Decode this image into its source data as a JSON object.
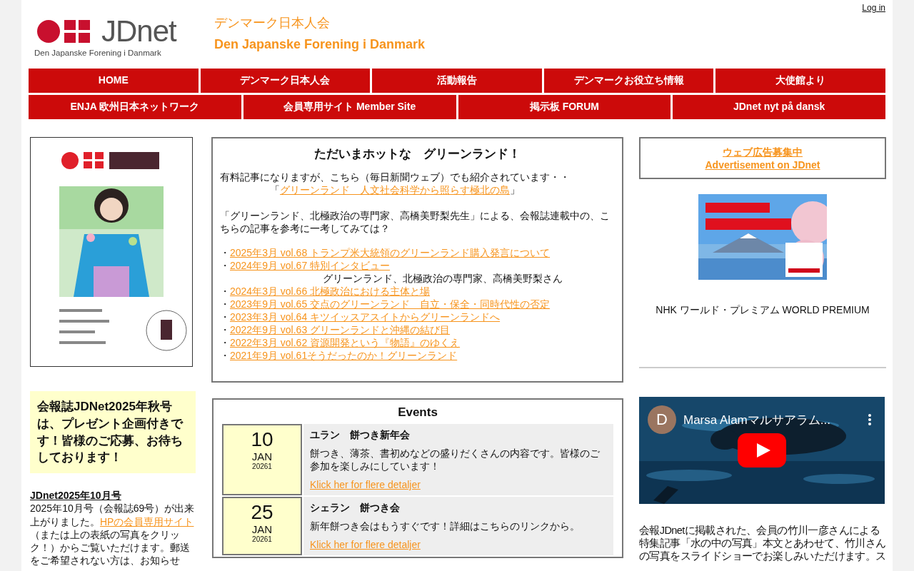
{
  "login": "Log in",
  "logo": {
    "name": "JDnet",
    "subtitle": "Den Japanske Forening i Danmark"
  },
  "site_title": {
    "ja": "デンマーク日本人会",
    "da": "Den Japanske Forening i Danmark"
  },
  "nav_rows": [
    [
      "HOME",
      "デンマーク日本人会",
      "活動報告",
      "デンマークお役立ち情報",
      "大使館より"
    ],
    [
      "ENJA 欧州日本ネットワーク",
      "会員専用サイト Member Site",
      "掲示板 FORUM",
      "JDnet nyt på dansk"
    ]
  ],
  "left": {
    "notice": "会報誌JDNet2025年秋号は、プレゼント企画付きです！皆様のご応募、お待ちしております！",
    "issue_title": "JDnet2025年10月号",
    "issue_text_before": "2025年10月号（会報誌69号）が出来上がりました。",
    "issue_link": "HPの会員専用サイト",
    "issue_text_after": "（または上の表紙の写真をクリック！）からご覧いただけます。郵送をご希望されない方は、お知らせ"
  },
  "hot": {
    "title": "ただいまホットな　グリーンランド！",
    "intro": "有料記事になりますが、こちら（毎日新聞ウェブ）でも紹介されています・・",
    "quote_open": "「",
    "quote_link": "グリーンランド　人文社会科学から照らす極北の島",
    "quote_close": "」",
    "lead": "「グリーンランド、北極政治の専門家、高橋美野梨先生」による、会報誌連載中の、こちらの記事を参考に一考してみては？",
    "bullet": "・",
    "articles": [
      {
        "link": "2025年3月 vol.68  トランプ米大統領のグリーンランド購入発言について"
      },
      {
        "link": "2024年9月 vol.67  特別インタビュー",
        "note": "グリーンランド、北極政治の専門家、高橋美野梨さん"
      },
      {
        "link": "2024年3月 vol.66  北極政治における主体と場"
      },
      {
        "link": "2023年9月 vol.65  交点のグリーンランド　自立・保全・同時代性の否定"
      },
      {
        "link": "2023年3月 vol.64  キツイッスアスイトからグリーンランドへ"
      },
      {
        "link": "2022年9月 vol.63  グリーンランドと沖縄の結び目"
      },
      {
        "link": "2022年3月 vol.62  資源開発という『物語』のゆくえ"
      },
      {
        "link": "2021年9月 vol.61そうだったのか！グリーンランド"
      }
    ]
  },
  "events": {
    "title": "Events",
    "items": [
      {
        "day": "10",
        "month": "JAN",
        "year": "20261",
        "title": "ユラン　餅つき新年会",
        "text": "餅つき、薄茶、書初めなどの盛りだくさんの内容です。皆様のご参加を楽しみにしています！",
        "link": "Klick her for flere detaljer"
      },
      {
        "day": "25",
        "month": "JAN",
        "year": "20261",
        "title": "シェラン　餅つき会",
        "text": "新年餅つき会はもうすぐです！詳細はこちらのリンクから。",
        "link": "Klick her for flere detaljer"
      }
    ]
  },
  "right": {
    "ad_links": [
      "ウェブ広告募集中",
      "Advertisement on JDnet"
    ],
    "banner_caption": "NHK ワールド・プレミアム WORLD PREMIUM",
    "video": {
      "avatar": "D",
      "title": "Marsa Alamマルサアラム..."
    },
    "video_text": "会報JDnetに掲載された、会員の竹川一彦さんによる特集記事「水の中の写真」本文とあわせて、竹川さんの写真をスライドショーでお楽しみいただけます。ス"
  }
}
